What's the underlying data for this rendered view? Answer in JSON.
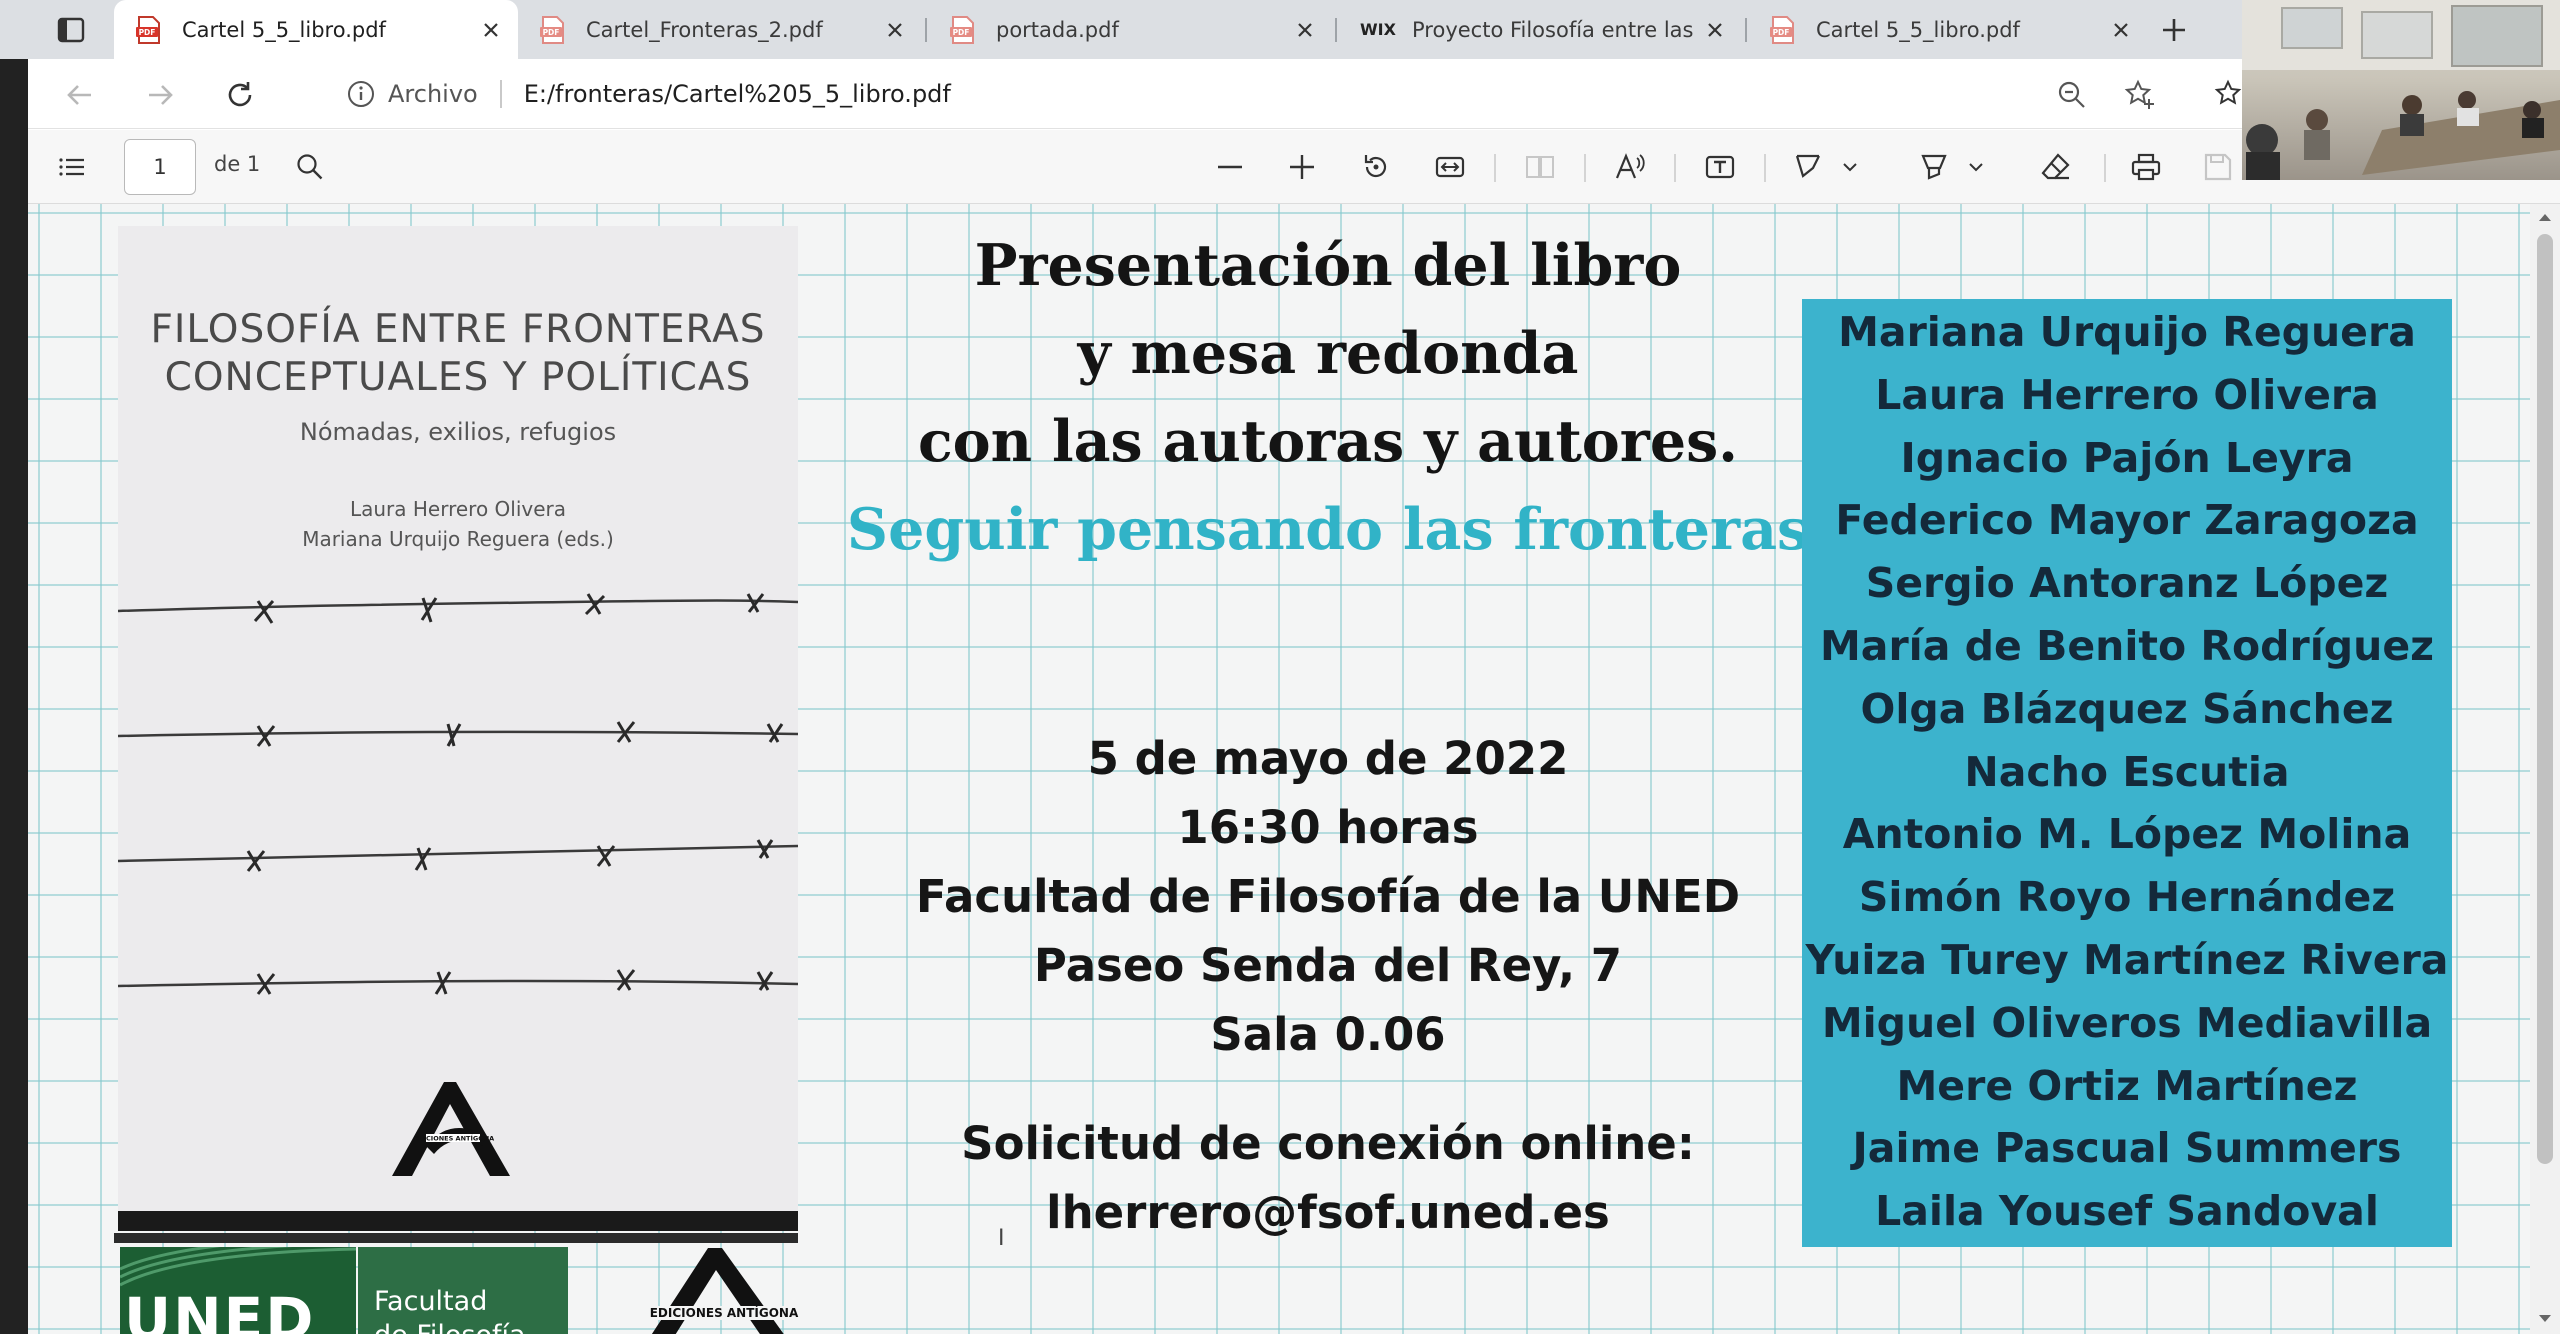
{
  "tabs": [
    {
      "title": "Cartel 5_5_libro.pdf",
      "icon": "pdf-icon",
      "active": true
    },
    {
      "title": "Cartel_Fronteras_2.pdf",
      "icon": "pdf-icon",
      "active": false
    },
    {
      "title": "portada.pdf",
      "icon": "pdf-icon",
      "active": false
    },
    {
      "title": "Proyecto Filosofía entre las fr",
      "icon": "wix-icon",
      "active": false
    },
    {
      "title": "Cartel 5_5_libro.pdf",
      "icon": "pdf-icon",
      "active": false
    }
  ],
  "wix_label": "WIX",
  "address": {
    "prefix": "Archivo",
    "url": "E:/fronteras/Cartel%205_5_libro.pdf"
  },
  "pdf_toolbar": {
    "page": "1",
    "total": "de 1"
  },
  "cover": {
    "title_line1": "FILOSOFÍA ENTRE FRONTERAS",
    "title_line2": "CONCEPTUALES Y POLÍTICAS",
    "subtitle": "Nómadas, exilios, refugios",
    "author1": "Laura Herrero Olivera",
    "author2": "Mariana Urquijo Reguera (eds.)",
    "publisher": "EDICIONES ANTÍGONA"
  },
  "poster": {
    "title_line1": "Presentación del libro",
    "title_line2": "y mesa redonda",
    "title_line3": "con las autoras y autores.",
    "title_line4": "Seguir pensando las fronteras",
    "date": "5 de mayo de 2022",
    "time": "16:30 horas",
    "place": "Facultad de Filosofía de la UNED",
    "address": "Paseo Senda del Rey, 7",
    "room": "Sala 0.06",
    "contact_label": "Solicitud de conexión online:",
    "contact_email": "lherrero@fsof.uned.es",
    "accent_color": "#31b3c7"
  },
  "speakers": [
    "Mariana Urquijo Reguera",
    "Laura Herrero Olivera",
    "Ignacio Pajón Leyra",
    "Federico Mayor Zaragoza",
    "Sergio Antoranz López",
    "María de Benito Rodríguez",
    "Olga Blázquez Sánchez",
    "Nacho Escutia",
    "Antonio M. López Molina",
    "Simón Royo Hernández",
    "Yuiza Turey Martínez Rivera",
    "Miguel Oliveros Mediavilla",
    "Mere Ortiz Martínez",
    "Jaime Pascual Summers",
    "Laila Yousef Sandoval"
  ],
  "logos": {
    "uned": "UNED",
    "facultad_line1": "Facultad",
    "facultad_line2": "de Filosofía",
    "antigona": "EDICIONES ANTÍGONA"
  }
}
